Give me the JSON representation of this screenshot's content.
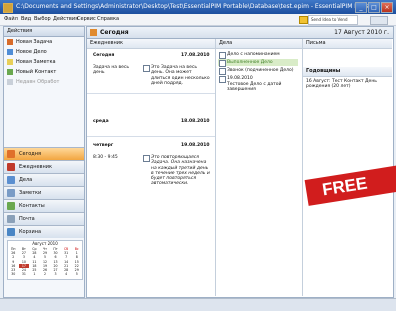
{
  "window": {
    "title": "C:\\Documents and Settings\\Administrator\\Desktop\\Test\\EssentialPIM Portable\\Database\\test.epim - EssentialPIM Portable",
    "buttons": [
      "_",
      "□",
      "×"
    ]
  },
  "menu": {
    "items": [
      "Файл",
      "Вид",
      "Выбор",
      "Действия",
      "Сервис",
      "Справка"
    ],
    "hint": "Send Idea to Vend"
  },
  "sidebar": {
    "header": "Действия",
    "actions": [
      {
        "label": "Новая Задача",
        "icon": "task-icon",
        "disabled": false
      },
      {
        "label": "Новое Дело",
        "icon": "todo-icon",
        "disabled": false
      },
      {
        "label": "Новая Заметка",
        "icon": "note-icon",
        "disabled": false
      },
      {
        "label": "Новый Контакт",
        "icon": "contact-icon",
        "disabled": false
      },
      {
        "label": "Недавн Обработ",
        "icon": "recent-icon",
        "disabled": true
      }
    ],
    "nav": [
      {
        "label": "Сегодня",
        "icon": "today-icon",
        "color": "#e0702a",
        "selected": true
      },
      {
        "label": "Ежедневник",
        "icon": "calendar-icon",
        "color": "#c0392b",
        "selected": false
      },
      {
        "label": "Дела",
        "icon": "todo-list-icon",
        "color": "#5b8fd0",
        "selected": false
      },
      {
        "label": "Заметки",
        "icon": "notes-icon",
        "color": "#7a9cc6",
        "selected": false
      },
      {
        "label": "Контакты",
        "icon": "contacts-icon",
        "color": "#6aa84f",
        "selected": false
      },
      {
        "label": "Почта",
        "icon": "mail-icon",
        "color": "#8aa0b8",
        "selected": false
      },
      {
        "label": "Корзина",
        "icon": "trash-icon",
        "color": "#4a86c5",
        "selected": false
      }
    ],
    "calendar": {
      "title": "Август 2010",
      "weekdays": [
        "Пн",
        "Вт",
        "Ср",
        "Чт",
        "Пт",
        "Сб",
        "Вс"
      ],
      "days": [
        "26",
        "27",
        "28",
        "29",
        "30",
        "31",
        "1",
        "2",
        "3",
        "4",
        "5",
        "6",
        "7",
        "8",
        "9",
        "10",
        "11",
        "12",
        "13",
        "14",
        "15",
        "16",
        "17",
        "18",
        "19",
        "20",
        "21",
        "22",
        "23",
        "24",
        "25",
        "26",
        "27",
        "28",
        "29",
        "30",
        "31",
        "1",
        "2",
        "3",
        "4",
        "5"
      ],
      "today": "17"
    }
  },
  "main": {
    "header": "Сегодня",
    "date": "17 Август 2010 г.",
    "columns": {
      "diary": "Ежедневник",
      "todo": "Дела",
      "mail": "Письма"
    },
    "diary": {
      "day1_label": "Сегодня",
      "day1_date": "17.08.2010",
      "allday_label": "Задача на весь день",
      "allday_text": "Это Задача на весь день. Она может длиться один несколько дней подряд.",
      "day2_label": "среда",
      "day2_date": "18.08.2010",
      "day3_label": "четверг",
      "day3_date": "19.08.2010",
      "time": "8:30 - 9:45",
      "task_text": "Это повторяющаяся Задача. Она назначена на каждый третий день в течение трех недель и будет повторяться автоматически."
    },
    "todo": {
      "items": [
        {
          "label": "Дело с напоминанием",
          "checked": false
        },
        {
          "label": "Выполненное Дело",
          "checked": true
        },
        {
          "label": "Звонок (подчиненное Дело)",
          "checked": false
        },
        {
          "label": "19.08.2010",
          "checked": false
        }
      ],
      "sub_text": "Тестовое Дело с датой завершения"
    },
    "mail": {
      "birthdays_header": "Годовщины",
      "birthday_text": "16 Август: Тест Контакт День рождения (20 лет)"
    }
  },
  "overlay": {
    "free_label": "FREE"
  }
}
